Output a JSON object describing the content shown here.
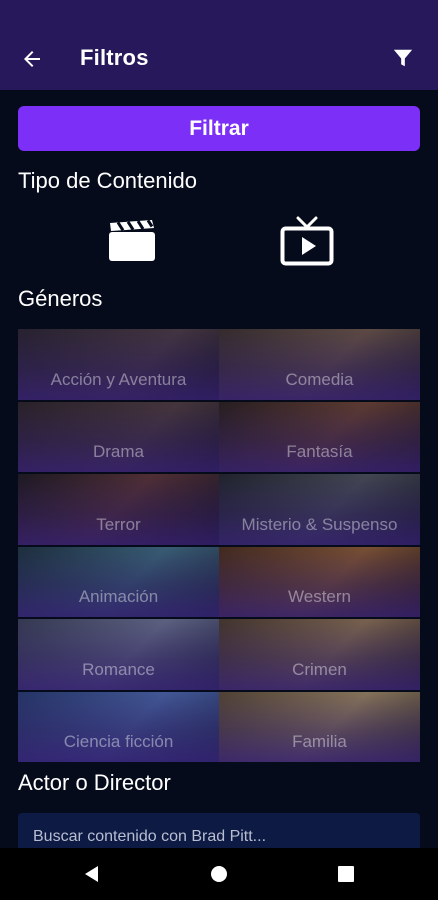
{
  "header": {
    "title": "Filtros",
    "icons": [
      "arrow-back-icon",
      "funnel-filter-icon"
    ]
  },
  "filter_button": {
    "label": "Filtrar"
  },
  "content_type": {
    "title": "Tipo de Contenido",
    "options": [
      {
        "icon": "movie-clapper-icon"
      },
      {
        "icon": "tv-icon"
      }
    ]
  },
  "genres": {
    "title": "Géneros",
    "items": [
      {
        "label": "Acción y Aventura",
        "tint": "#3a3140"
      },
      {
        "label": "Comedia",
        "tint": "#4a3b3a"
      },
      {
        "label": "Drama",
        "tint": "#3b3236"
      },
      {
        "label": "Fantasía",
        "tint": "#46302c"
      },
      {
        "label": "Terror",
        "tint": "#3c2a2c"
      },
      {
        "label": "Misterio & Suspenso",
        "tint": "#384048"
      },
      {
        "label": "Animación",
        "tint": "#2f4a5a"
      },
      {
        "label": "Western",
        "tint": "#5a3a26"
      },
      {
        "label": "Romance",
        "tint": "#4a4f70"
      },
      {
        "label": "Crimen",
        "tint": "#5a4a3a"
      },
      {
        "label": "Ciencia ficción",
        "tint": "#3a4a78"
      },
      {
        "label": "Familia",
        "tint": "#6a5a44"
      }
    ]
  },
  "actor": {
    "title": "Actor o Director",
    "placeholder": "Buscar contenido con Brad Pitt..."
  },
  "navbar": {
    "icons": [
      "nav-back-icon",
      "nav-home-icon",
      "nav-recents-icon"
    ]
  }
}
